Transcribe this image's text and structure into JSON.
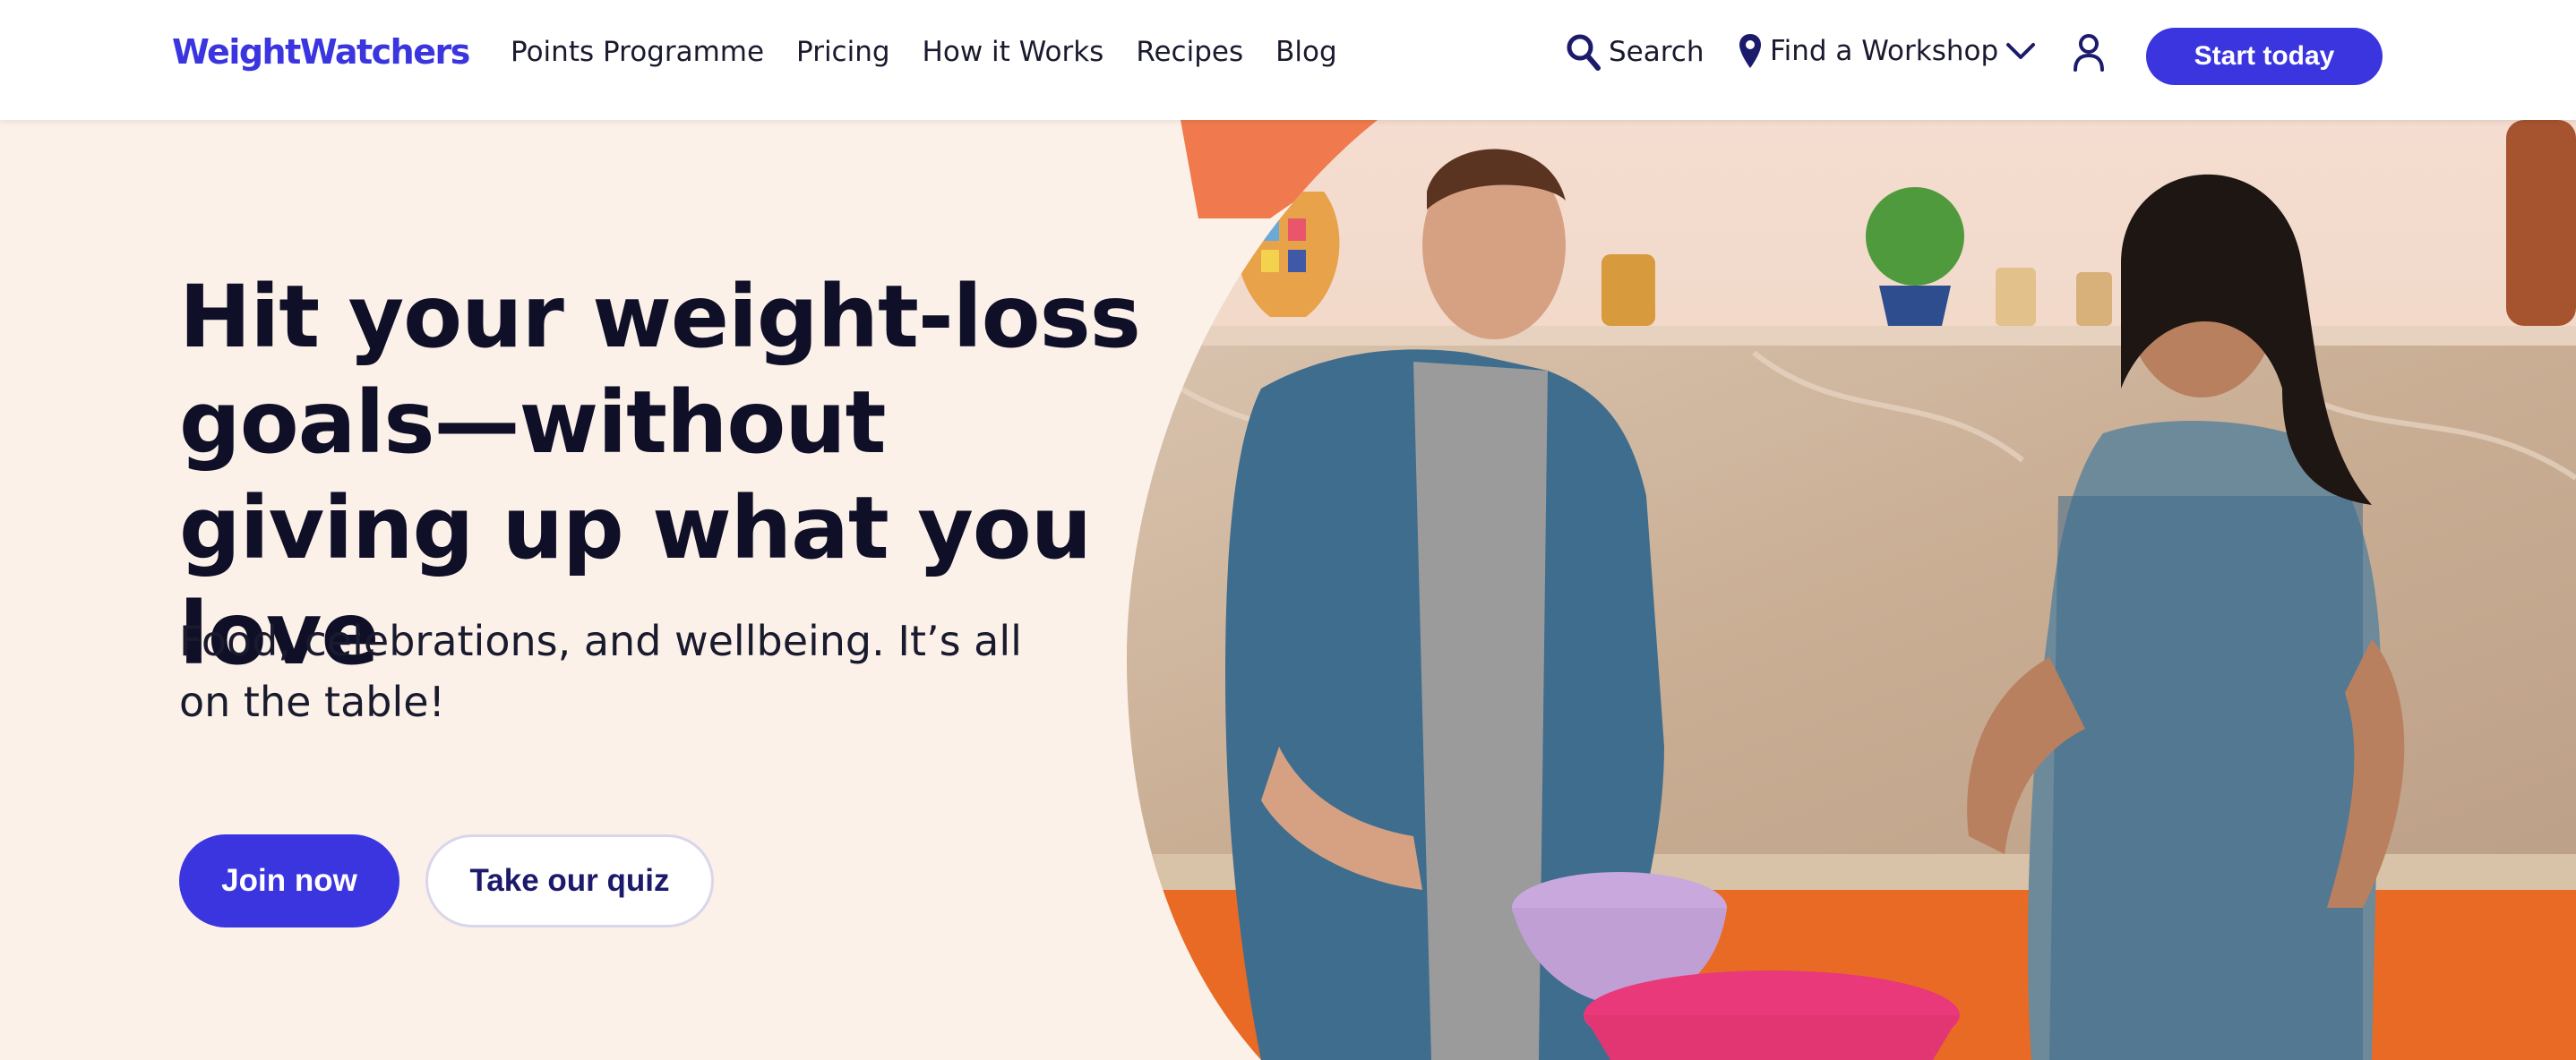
{
  "header": {
    "logo": "WeightWatchers",
    "nav": [
      "Points Programme",
      "Pricing",
      "How it Works",
      "Recipes",
      "Blog"
    ],
    "search_label": "Search",
    "workshop_label": "Find a Workshop",
    "cta_label": "Start today"
  },
  "hero": {
    "title": "Hit your weight-loss goals—without giving up what you love",
    "subtitle": "Food, celebrations, and wellbeing. It’s all on the table!",
    "join_label": "Join now",
    "quiz_label": "Take our quiz"
  },
  "colors": {
    "brand": "#3b35e0",
    "background": "#fbf1e9",
    "accent_orange": "#f07a4e"
  },
  "icons": [
    "search-icon",
    "location-pin-icon",
    "chevron-down-icon",
    "user-icon"
  ]
}
